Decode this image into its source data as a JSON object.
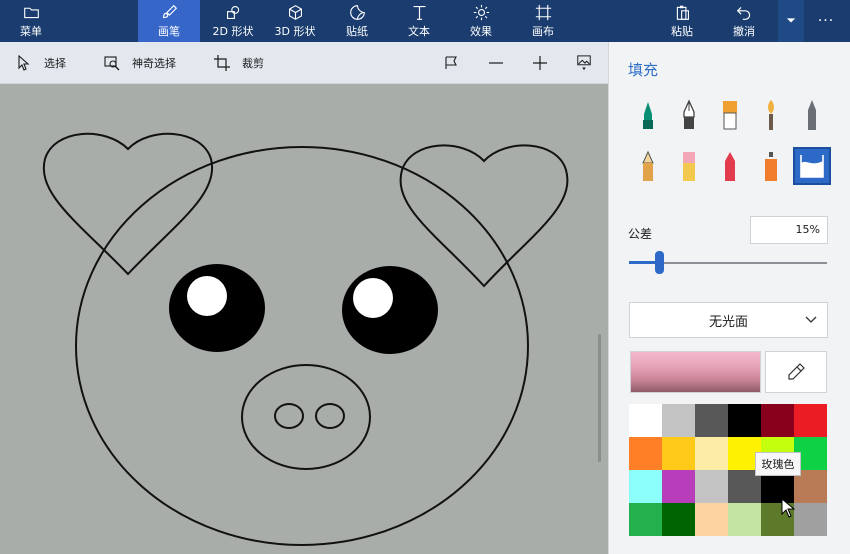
{
  "ribbon": {
    "menu": "菜单",
    "tools": [
      {
        "label": "画笔",
        "icon": "brush-icon",
        "active": true
      },
      {
        "label": "2D 形状",
        "icon": "2d-shapes-icon",
        "active": false
      },
      {
        "label": "3D 形状",
        "icon": "3d-shapes-icon",
        "active": false
      },
      {
        "label": "贴纸",
        "icon": "sticker-icon",
        "active": false
      },
      {
        "label": "文本",
        "icon": "text-icon",
        "active": false
      },
      {
        "label": "效果",
        "icon": "effects-icon",
        "active": false
      },
      {
        "label": "画布",
        "icon": "canvas-icon",
        "active": false
      }
    ],
    "paste": "粘贴",
    "undo": "撤消",
    "more": "···"
  },
  "toolbar2": {
    "select": "选择",
    "magic_select": "神奇选择",
    "crop": "裁剪"
  },
  "panel": {
    "title": "填充",
    "tolerance_label": "公差",
    "tolerance_value": "15%",
    "tolerance_fraction": 0.15,
    "finish": "无光面",
    "current_color": "#e7a4b9",
    "tooltip": "玫瑰色"
  },
  "palette_colors": [
    "#ffffff",
    "#c3c3c3",
    "#585858",
    "#000000",
    "#88001b",
    "#ec1c24",
    "#ff7f27",
    "#ffca18",
    "#fdeca6",
    "#fff200",
    "#c4ff0e",
    "#0ed145",
    "#8cfffb",
    "#b83dba",
    "#c3c3c3",
    "#585858",
    "#000000",
    "#b97a56",
    "#22b14c",
    "#006400",
    "#fdd39f",
    "#c4e4a1",
    "#5d7a2a",
    "#a0a0a0"
  ],
  "brush_colors": [
    "#0b8f73",
    "#555555",
    "#f0a030",
    "#f0b040",
    "#6a6f76",
    "#e2a24a",
    "#f3a7b6",
    "#e23b4e",
    "#f07c2c",
    "#2d6ac8"
  ]
}
